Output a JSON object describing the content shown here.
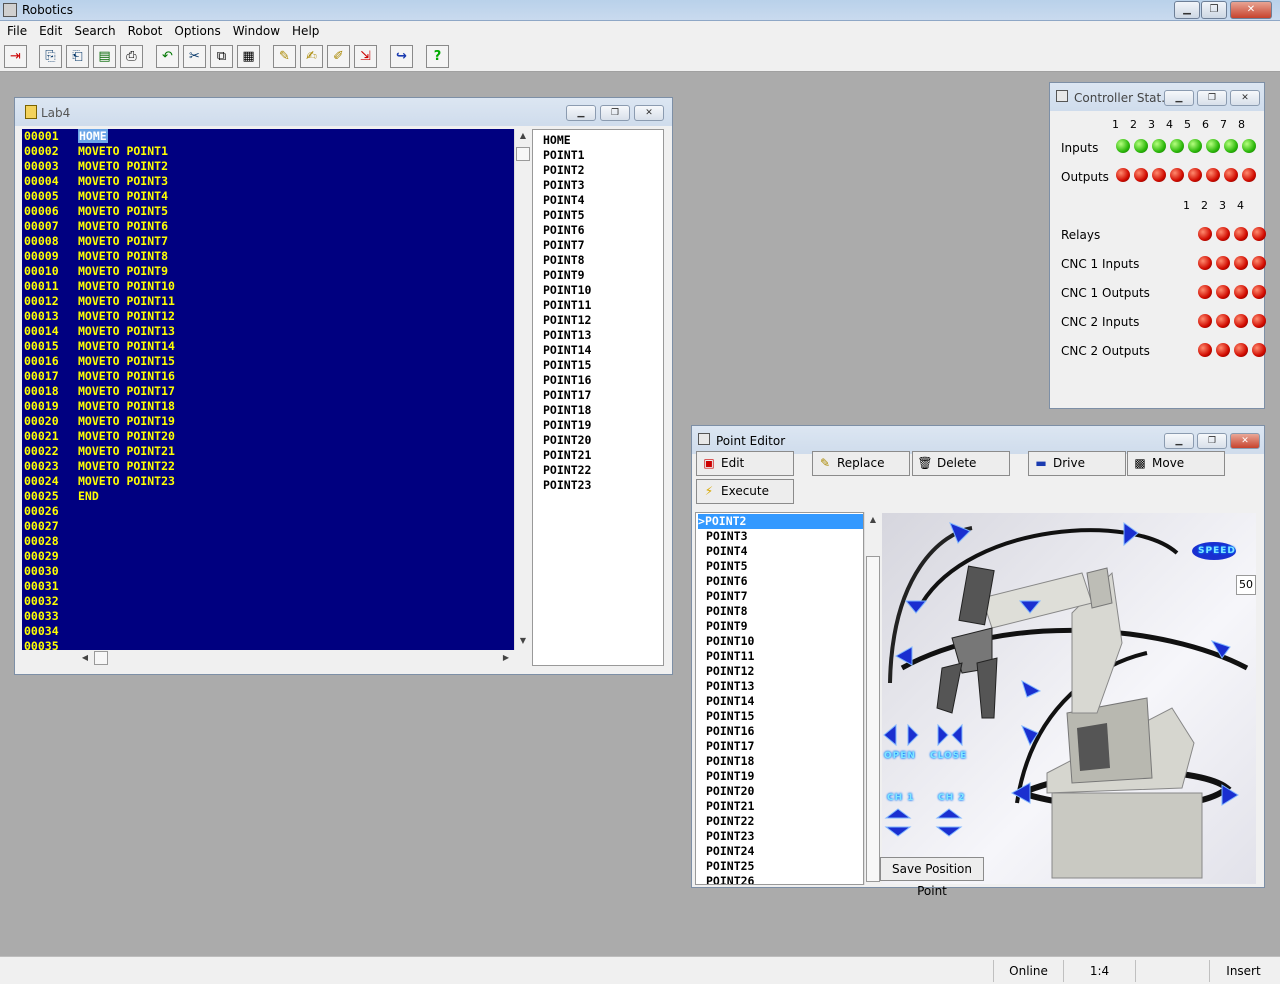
{
  "app": {
    "title": "Robotics"
  },
  "menu": [
    "File",
    "Edit",
    "Search",
    "Robot",
    "Options",
    "Window",
    "Help"
  ],
  "lab": {
    "title": "Lab4",
    "code": [
      {
        "ln": "00001",
        "text": "HOME",
        "sel": true
      },
      {
        "ln": "00002",
        "text": "MOVETO POINT1"
      },
      {
        "ln": "00003",
        "text": "MOVETO POINT2"
      },
      {
        "ln": "00004",
        "text": "MOVETO POINT3"
      },
      {
        "ln": "00005",
        "text": "MOVETO POINT4"
      },
      {
        "ln": "00006",
        "text": "MOVETO POINT5"
      },
      {
        "ln": "00007",
        "text": "MOVETO POINT6"
      },
      {
        "ln": "00008",
        "text": "MOVETO POINT7"
      },
      {
        "ln": "00009",
        "text": "MOVETO POINT8"
      },
      {
        "ln": "00010",
        "text": "MOVETO POINT9"
      },
      {
        "ln": "00011",
        "text": "MOVETO POINT10"
      },
      {
        "ln": "00012",
        "text": "MOVETO POINT11"
      },
      {
        "ln": "00013",
        "text": "MOVETO POINT12"
      },
      {
        "ln": "00014",
        "text": "MOVETO POINT13"
      },
      {
        "ln": "00015",
        "text": "MOVETO POINT14"
      },
      {
        "ln": "00016",
        "text": "MOVETO POINT15"
      },
      {
        "ln": "00017",
        "text": "MOVETO POINT16"
      },
      {
        "ln": "00018",
        "text": "MOVETO POINT17"
      },
      {
        "ln": "00019",
        "text": "MOVETO POINT18"
      },
      {
        "ln": "00020",
        "text": "MOVETO POINT19"
      },
      {
        "ln": "00021",
        "text": "MOVETO POINT20"
      },
      {
        "ln": "00022",
        "text": "MOVETO POINT21"
      },
      {
        "ln": "00023",
        "text": "MOVETO POINT22"
      },
      {
        "ln": "00024",
        "text": "MOVETO POINT23"
      },
      {
        "ln": "00025",
        "text": "END"
      },
      {
        "ln": "00026",
        "text": ""
      },
      {
        "ln": "00027",
        "text": ""
      },
      {
        "ln": "00028",
        "text": ""
      },
      {
        "ln": "00029",
        "text": ""
      },
      {
        "ln": "00030",
        "text": ""
      },
      {
        "ln": "00031",
        "text": ""
      },
      {
        "ln": "00032",
        "text": ""
      },
      {
        "ln": "00033",
        "text": ""
      },
      {
        "ln": "00034",
        "text": ""
      },
      {
        "ln": "00035",
        "text": ""
      }
    ],
    "points": [
      "HOME",
      "POINT1",
      "POINT2",
      "POINT3",
      "POINT4",
      "POINT5",
      "POINT6",
      "POINT7",
      "POINT8",
      "POINT9",
      "POINT10",
      "POINT11",
      "POINT12",
      "POINT13",
      "POINT14",
      "POINT15",
      "POINT16",
      "POINT17",
      "POINT18",
      "POINT19",
      "POINT20",
      "POINT21",
      "POINT22",
      "POINT23"
    ]
  },
  "controller": {
    "title": "Controller Stat...",
    "io_numbers": [
      "1",
      "2",
      "3",
      "4",
      "5",
      "6",
      "7",
      "8"
    ],
    "relay_numbers": [
      "1",
      "2",
      "3",
      "4"
    ],
    "inputs_label": "Inputs",
    "outputs_label": "Outputs",
    "inputs": [
      "on",
      "on",
      "on",
      "on",
      "on",
      "on",
      "on",
      "on"
    ],
    "outputs": [
      "off",
      "off",
      "off",
      "off",
      "off",
      "off",
      "off",
      "off"
    ],
    "rows": [
      {
        "label": "Relays"
      },
      {
        "label": "CNC 1 Inputs"
      },
      {
        "label": "CNC 1 Outputs"
      },
      {
        "label": "CNC 2 Inputs"
      },
      {
        "label": "CNC 2 Outputs"
      }
    ]
  },
  "point_editor": {
    "title": "Point Editor",
    "buttons": {
      "edit": "Edit",
      "execute": "Execute",
      "replace": "Replace",
      "delete": "Delete",
      "drive": "Drive",
      "move": "Move"
    },
    "points": [
      "POINT2",
      "POINT3",
      "POINT4",
      "POINT5",
      "POINT6",
      "POINT7",
      "POINT8",
      "POINT9",
      "POINT10",
      "POINT11",
      "POINT12",
      "POINT13",
      "POINT14",
      "POINT15",
      "POINT16",
      "POINT17",
      "POINT18",
      "POINT19",
      "POINT20",
      "POINT21",
      "POINT22",
      "POINT23",
      "POINT24",
      "POINT25",
      "POINT26"
    ],
    "selected_prefix": ">",
    "speed_label": "SPEED",
    "speed_value": "50",
    "open_label": "OPEN",
    "close_label": "CLOSE",
    "ch1_label": "CH 1",
    "ch2_label": "CH 2",
    "save_label": "Save Position Point"
  },
  "status": {
    "state": "Online",
    "position": "1:4",
    "mode": "Insert"
  }
}
